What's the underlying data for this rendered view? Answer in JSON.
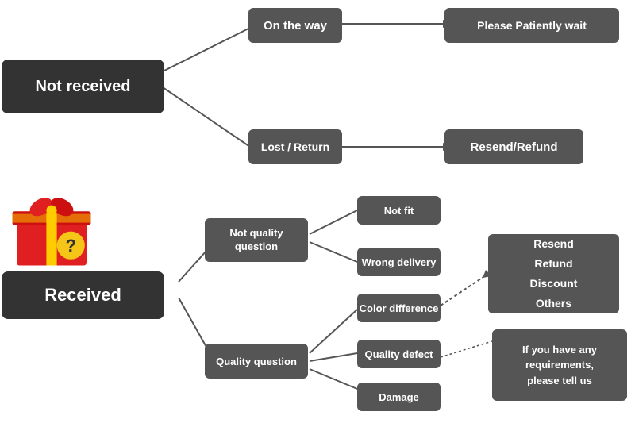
{
  "nodes": {
    "not_received": {
      "label": "Not received"
    },
    "on_the_way": {
      "label": "On the way"
    },
    "please_wait": {
      "label": "Please Patiently wait"
    },
    "lost_return": {
      "label": "Lost / Return"
    },
    "resend_refund_1": {
      "label": "Resend/Refund"
    },
    "received": {
      "label": "Received"
    },
    "not_quality": {
      "label": "Not quality\nquestion"
    },
    "quality_question": {
      "label": "Quality question"
    },
    "not_fit": {
      "label": "Not fit"
    },
    "wrong_delivery": {
      "label": "Wrong delivery"
    },
    "color_difference": {
      "label": "Color difference"
    },
    "quality_defect": {
      "label": "Quality defect"
    },
    "damage": {
      "label": "Damage"
    },
    "resend_refund_2": {
      "label": "Resend\nRefund\nDiscount\nOthers"
    },
    "requirements": {
      "label": "If you have any\nrequirements,\nplease tell us"
    }
  },
  "colors": {
    "dark_node": "#555555",
    "large_node": "#2a2a2a",
    "arrow": "#555555"
  }
}
